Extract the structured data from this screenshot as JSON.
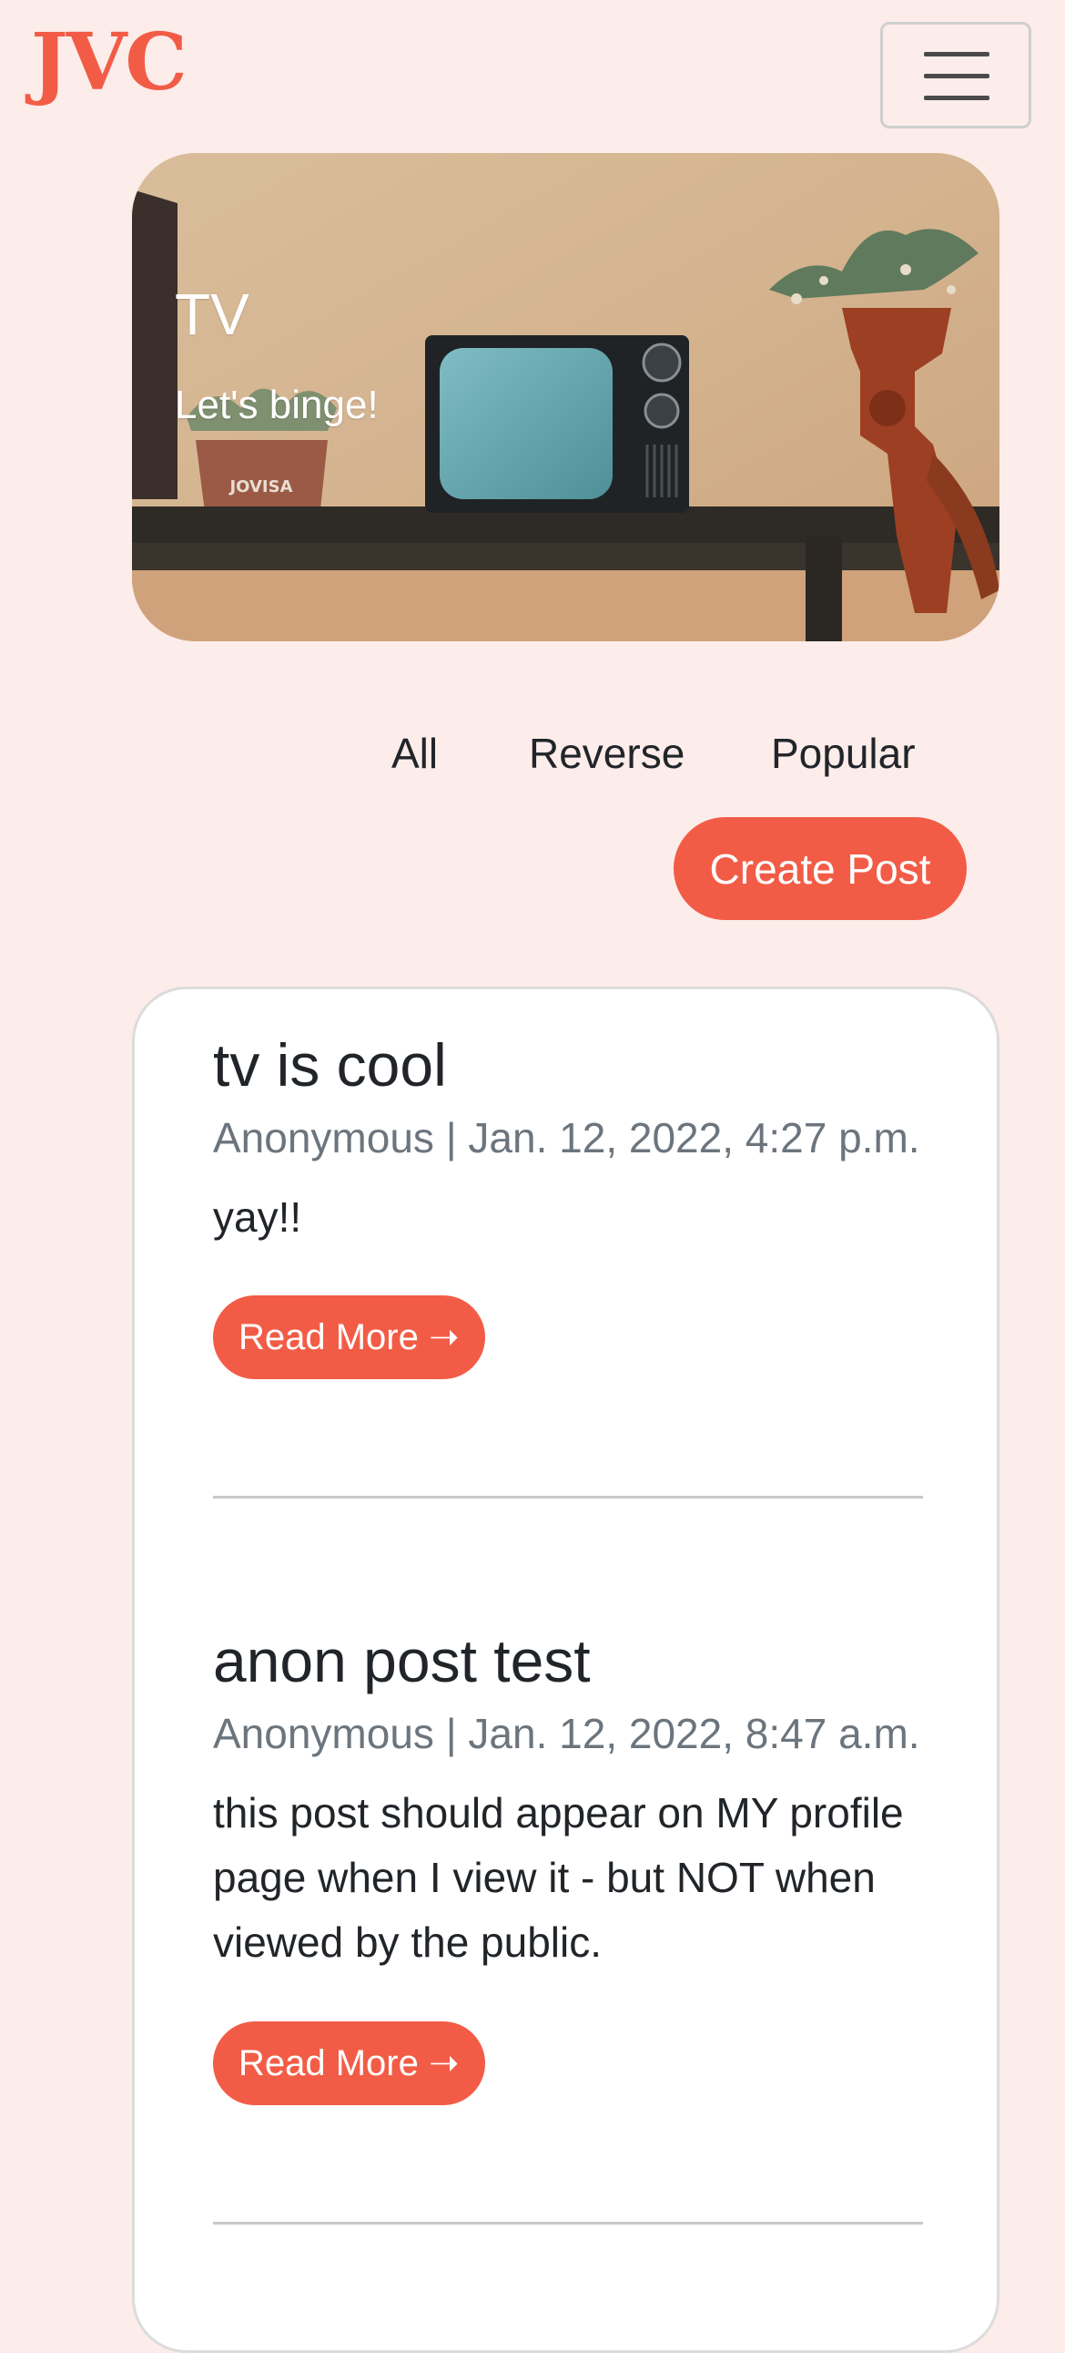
{
  "header": {
    "brand": "JVC",
    "menu_icon": "hamburger-menu-icon"
  },
  "hero": {
    "title": "TV",
    "subtitle": "Let's binge!",
    "planter_label": "JOVISA"
  },
  "filters": {
    "tabs": [
      "All",
      "Reverse",
      "Popular"
    ],
    "create_post_label": "Create Post"
  },
  "posts": [
    {
      "title": "tv is cool",
      "meta": "Anonymous | Jan. 12, 2022, 4:27 p.m.",
      "body": "yay!!",
      "read_more": "Read More ➝"
    },
    {
      "title": "anon post test",
      "meta": "Anonymous | Jan. 12, 2022, 8:47 a.m.",
      "body": "this post should appear on MY profile page when I view it - but NOT when viewed by the public.",
      "read_more": "Read More ➝"
    }
  ],
  "colors": {
    "accent": "#f25c46",
    "background": "#fcecea",
    "meta_text": "#6c757d"
  }
}
